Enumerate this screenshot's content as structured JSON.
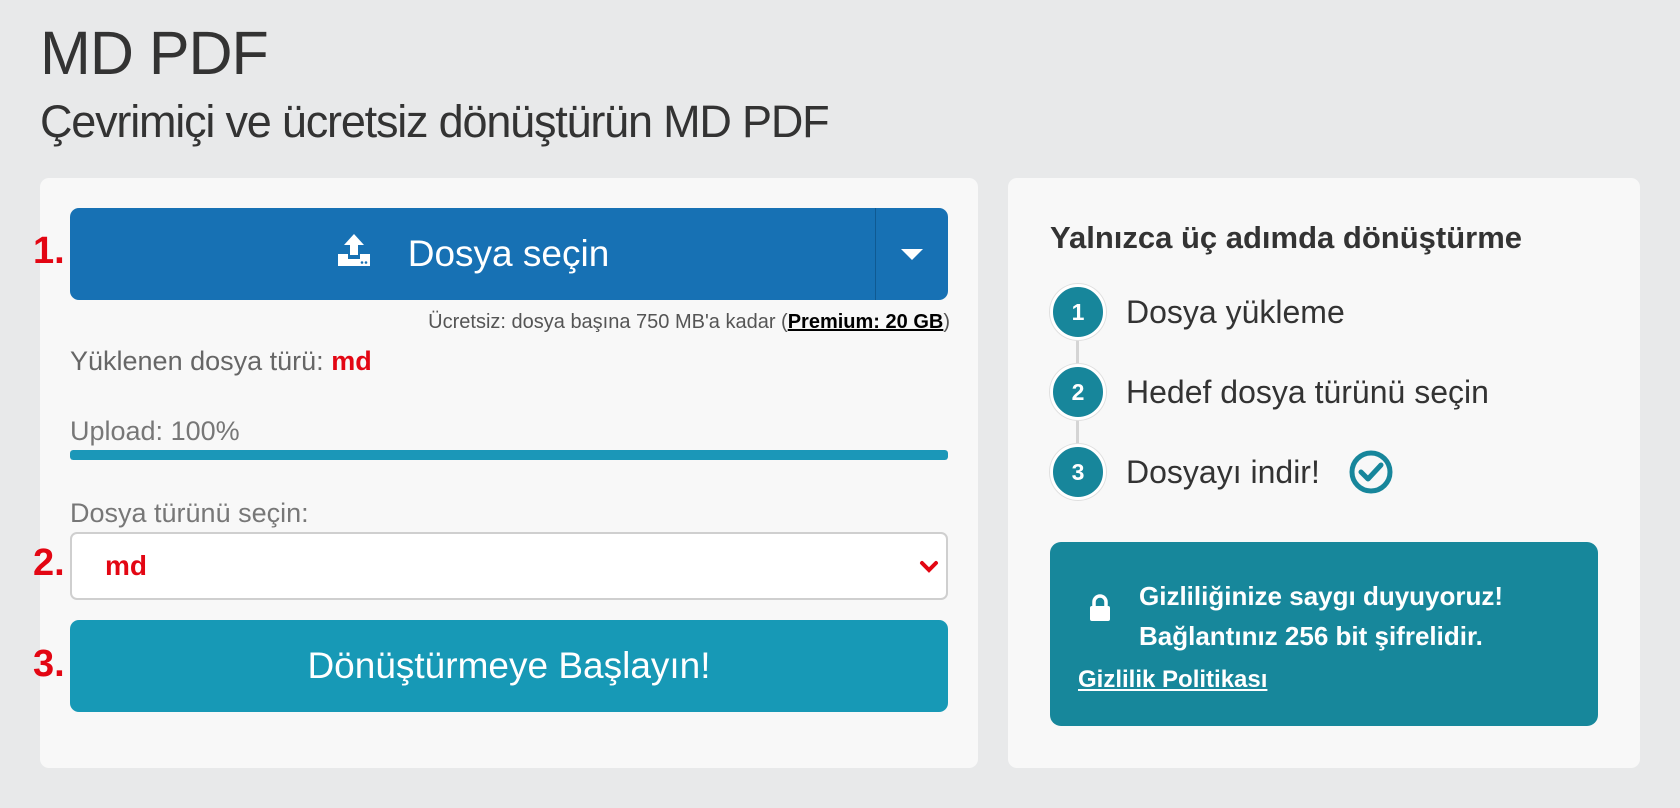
{
  "header": {
    "title": "MD PDF",
    "subtitle": "Çevrimiçi ve ücretsiz dönüştürün MD PDF"
  },
  "converter": {
    "step_numbers": [
      "1.",
      "2.",
      "3."
    ],
    "upload_button_label": "Dosya seçin",
    "limit_note_prefix": "Ücretsiz: dosya başına 750 MB'a kadar (",
    "limit_note_premium": "Premium: 20 GB",
    "limit_note_suffix": ")",
    "uploaded_type_label": "Yüklenen dosya türü:",
    "uploaded_type_value": "md",
    "upload_progress_label": "Upload: 100%",
    "upload_progress": 1.0,
    "select_label": "Dosya türünü seçin:",
    "select_value": "md",
    "convert_button_label": "Dönüştürmeye Başlayın!"
  },
  "steps": {
    "title": "Yalnızca üç adımda dönüştürme",
    "items": [
      {
        "number": "1",
        "label": "Dosya yükleme"
      },
      {
        "number": "2",
        "label": "Hedef dosya türünü seçin"
      },
      {
        "number": "3",
        "label": "Dosyayı indir!"
      }
    ]
  },
  "privacy": {
    "line1": "Gizliliğinize saygı duyuyoruz!",
    "line2": "Bağlantınız 256 bit şifrelidir.",
    "link": "Gizlilik Politikası"
  },
  "colors": {
    "upload_button": "#1771b4",
    "convert_button": "#1799b6",
    "step_circle": "#17869b",
    "privacy_box": "#17879b",
    "accent_red": "#e30613"
  },
  "icons": {
    "upload": "upload-icon",
    "caret": "caret-down-icon",
    "chevron": "chevron-down-icon",
    "check": "check-circle-icon",
    "lock": "lock-icon"
  }
}
